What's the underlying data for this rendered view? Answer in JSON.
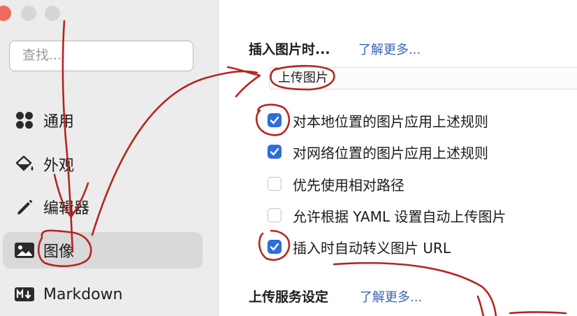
{
  "sidebar": {
    "search_placeholder": "查找...",
    "items": [
      {
        "label": "通用",
        "icon": "grid-icon",
        "selected": false
      },
      {
        "label": "外观",
        "icon": "paint-bucket-icon",
        "selected": false
      },
      {
        "label": "编辑器",
        "icon": "pencil-icon",
        "selected": false
      },
      {
        "label": "图像",
        "icon": "image-icon",
        "selected": true
      },
      {
        "label": "Markdown",
        "icon": "markdown-icon",
        "selected": false
      }
    ]
  },
  "main": {
    "insert_section": {
      "title": "插入图片时...",
      "learn_more": "了解更多...",
      "select_value": "上传图片",
      "options": [
        {
          "label": "对本地位置的图片应用上述规则",
          "checked": true
        },
        {
          "label": "对网络位置的图片应用上述规则",
          "checked": true
        },
        {
          "label": "优先使用相对路径",
          "checked": false
        },
        {
          "label": "允许根据 YAML 设置自动上传图片",
          "checked": false
        },
        {
          "label": "插入时自动转义图片 URL",
          "checked": true
        }
      ]
    },
    "upload_section": {
      "title": "上传服务设定",
      "learn_more": "了解更多..."
    }
  },
  "colors": {
    "accent": "#2d6fdc",
    "link": "#3a64b8",
    "annotation": "#b3261e",
    "sidebar_bg": "#ececec",
    "selected_bg": "#d9d9d9"
  }
}
